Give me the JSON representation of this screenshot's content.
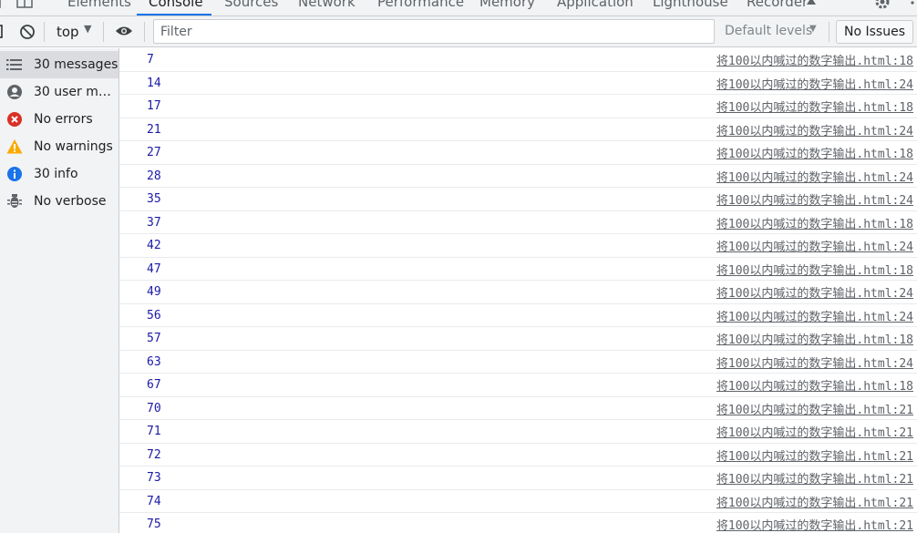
{
  "tabs": [
    {
      "label": "Elements"
    },
    {
      "label": "Console"
    },
    {
      "label": "Sources"
    },
    {
      "label": "Network"
    },
    {
      "label": "Performance"
    },
    {
      "label": "Memory"
    },
    {
      "label": "Application"
    },
    {
      "label": "Lighthouse"
    },
    {
      "label": "Recorder"
    }
  ],
  "toolbar": {
    "context": "top",
    "filter_placeholder": "Filter",
    "levels_label": "Default levels",
    "issues_label": "No Issues"
  },
  "sidebar": {
    "items": [
      {
        "label": "30 messages",
        "icon": "list-icon"
      },
      {
        "label": "30 user mes...",
        "icon": "user-icon"
      },
      {
        "label": "No errors",
        "icon": "error-icon"
      },
      {
        "label": "No warnings",
        "icon": "warning-icon"
      },
      {
        "label": "30 info",
        "icon": "info-icon"
      },
      {
        "label": "No verbose",
        "icon": "bug-icon"
      }
    ]
  },
  "colors": {
    "error": "#d93025",
    "warning": "#f9ab00",
    "info": "#1a73e8",
    "log_number": "#1a1aa6"
  },
  "messages": [
    {
      "value": "7",
      "source": "将100以内喊过的数字输出.html:18"
    },
    {
      "value": "14",
      "source": "将100以内喊过的数字输出.html:24"
    },
    {
      "value": "17",
      "source": "将100以内喊过的数字输出.html:18"
    },
    {
      "value": "21",
      "source": "将100以内喊过的数字输出.html:24"
    },
    {
      "value": "27",
      "source": "将100以内喊过的数字输出.html:18"
    },
    {
      "value": "28",
      "source": "将100以内喊过的数字输出.html:24"
    },
    {
      "value": "35",
      "source": "将100以内喊过的数字输出.html:24"
    },
    {
      "value": "37",
      "source": "将100以内喊过的数字输出.html:18"
    },
    {
      "value": "42",
      "source": "将100以内喊过的数字输出.html:24"
    },
    {
      "value": "47",
      "source": "将100以内喊过的数字输出.html:18"
    },
    {
      "value": "49",
      "source": "将100以内喊过的数字输出.html:24"
    },
    {
      "value": "56",
      "source": "将100以内喊过的数字输出.html:24"
    },
    {
      "value": "57",
      "source": "将100以内喊过的数字输出.html:18"
    },
    {
      "value": "63",
      "source": "将100以内喊过的数字输出.html:24"
    },
    {
      "value": "67",
      "source": "将100以内喊过的数字输出.html:18"
    },
    {
      "value": "70",
      "source": "将100以内喊过的数字输出.html:21"
    },
    {
      "value": "71",
      "source": "将100以内喊过的数字输出.html:21"
    },
    {
      "value": "72",
      "source": "将100以内喊过的数字输出.html:21"
    },
    {
      "value": "73",
      "source": "将100以内喊过的数字输出.html:21"
    },
    {
      "value": "74",
      "source": "将100以内喊过的数字输出.html:21"
    },
    {
      "value": "75",
      "source": "将100以内喊过的数字输出.html:21"
    }
  ]
}
